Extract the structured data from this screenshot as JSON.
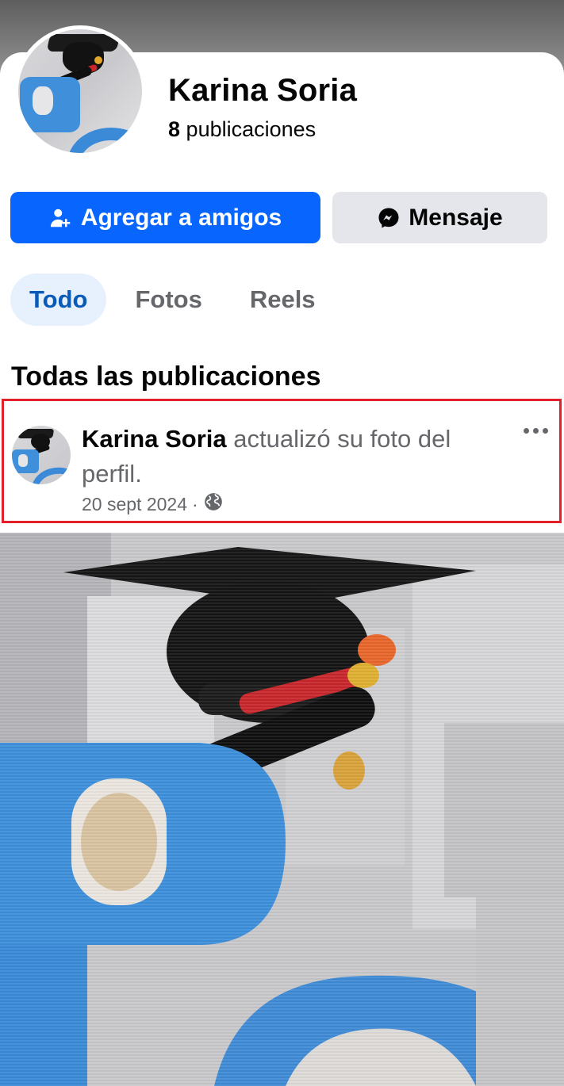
{
  "profile": {
    "name": "Karina Soria",
    "posts_count": "8",
    "posts_label": "publicaciones"
  },
  "actions": {
    "add_friend_label": "Agregar a amigos",
    "message_label": "Mensaje"
  },
  "tabs": [
    {
      "label": "Todo",
      "active": true
    },
    {
      "label": "Fotos",
      "active": false
    },
    {
      "label": "Reels",
      "active": false
    }
  ],
  "feed": {
    "section_title": "Todas las publicaciones",
    "post": {
      "author": "Karina Soria",
      "action_text": "actualizó su foto del perfil.",
      "date": "20 sept 2024",
      "separator": "·",
      "privacy_icon": "globe-icon",
      "menu_icon": "more-horizontal-icon"
    }
  },
  "colors": {
    "primary_button": "#0866ff",
    "secondary_button": "#e4e6eb",
    "active_tab_bg": "#e7f1fd",
    "active_tab_text": "#0a5ab8",
    "secondary_text": "#65676b",
    "highlight_border": "#e3202a"
  }
}
